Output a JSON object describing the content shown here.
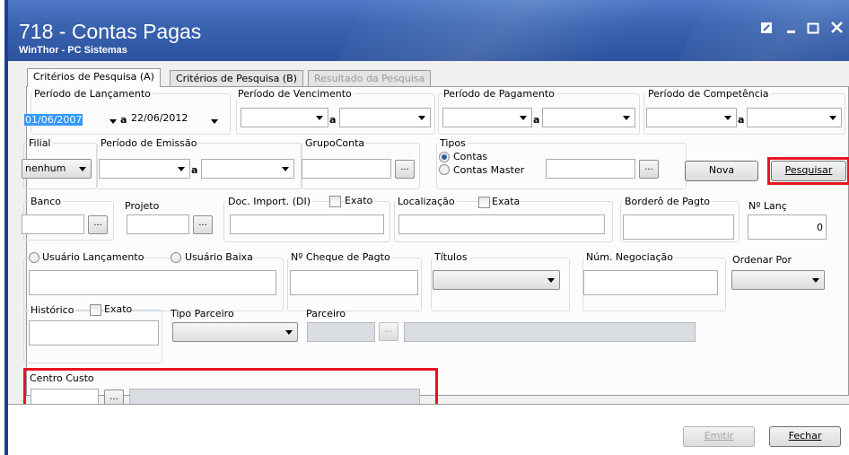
{
  "window": {
    "title": "718 - Contas Pagas",
    "subtitle": "WinThor - PC Sistemas"
  },
  "tabs": [
    {
      "label": "Critérios de Pesquisa (A)"
    },
    {
      "label": "Critérios de Pesquisa (B)"
    },
    {
      "label": "Resultado da Pesquisa"
    }
  ],
  "form": {
    "periodo_lancamento": {
      "label": "Período de Lançamento",
      "from": "01/06/2007",
      "sep": "a",
      "to": "22/06/2012"
    },
    "periodo_vencimento": {
      "label": "Período de Vencimento",
      "sep": "a"
    },
    "periodo_pagamento": {
      "label": "Período de Pagamento",
      "sep": "a"
    },
    "periodo_competencia": {
      "label": "Período de Competência",
      "sep": "a"
    },
    "filial": {
      "label": "Filial",
      "value": "nenhum"
    },
    "periodo_emissao": {
      "label": "Período de Emissão",
      "sep": "a"
    },
    "grupo_conta": {
      "label": "GrupoConta",
      "button": "..."
    },
    "tipos": {
      "label": "Tipos",
      "option1": "Contas",
      "option2": "Contas Master",
      "button": "..."
    },
    "banco": {
      "label": "Banco",
      "button": "..."
    },
    "projeto": {
      "label": "Projeto",
      "button": "..."
    },
    "doc_import": {
      "label": "Doc. Import. (DI)",
      "check": "Exato"
    },
    "localizacao": {
      "label": "Localização",
      "check": "Exata"
    },
    "bordero": {
      "label": "Borderô de Pagto"
    },
    "num_lanc": {
      "label": "Nº Lanç",
      "value": "0"
    },
    "usuario_lancamento": {
      "label": "Usuário Lançamento"
    },
    "usuario_baixa": {
      "label": "Usuário Baixa"
    },
    "cheque": {
      "label": "Nº Cheque de Pagto"
    },
    "titulos": {
      "label": "Títulos"
    },
    "num_negociacao": {
      "label": "Núm. Negociação"
    },
    "ordenar_por": {
      "label": "Ordenar Por"
    },
    "historico": {
      "label": "Histórico",
      "check": "Exato"
    },
    "tipo_parceiro": {
      "label": "Tipo Parceiro"
    },
    "parceiro": {
      "label": "Parceiro",
      "button": "..."
    },
    "centro_custo": {
      "label": "Centro Custo",
      "button": "..."
    }
  },
  "buttons": {
    "nova": "Nova",
    "pesquisar": "Pesquisar",
    "emitir": "Emitir",
    "fechar": "Fechar"
  },
  "colors": {
    "titlebar": "#3a63b0",
    "highlight_red": "#e8141e",
    "selection": "#3399ff"
  }
}
